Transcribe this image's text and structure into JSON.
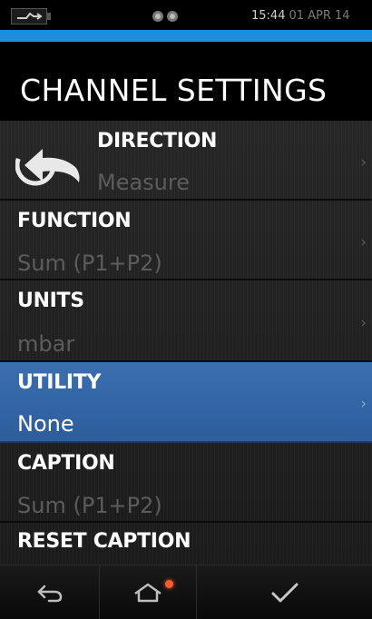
{
  "status": {
    "time": "15:44",
    "date": "01 APR 14",
    "battery_icon": "battery-charging-icon",
    "storage_icon": "sd-card-icon",
    "accent_color": "#1d8ddd"
  },
  "title": "CHANNEL SETTINGS",
  "settings": [
    {
      "label": "DIRECTION",
      "value": "Measure",
      "icon": "direction-arrow-icon",
      "selected": false
    },
    {
      "label": "FUNCTION",
      "value": "Sum (P1+P2)",
      "selected": false
    },
    {
      "label": "UNITS",
      "value": "mbar",
      "selected": false
    },
    {
      "label": "UTILITY",
      "value": "None",
      "selected": true
    },
    {
      "label": "CAPTION",
      "value": "Sum (P1+P2)",
      "selected": false
    },
    {
      "label": "RESET CAPTION",
      "selected": false
    }
  ],
  "chevron": "›",
  "nav": {
    "back_icon": "back-arrow-icon",
    "home_icon": "home-icon",
    "confirm_icon": "checkmark-icon",
    "notification_color": "#ff5a2a"
  },
  "colors": {
    "selected_row": "#2d5d9b",
    "value_text": "#5c5c5c"
  }
}
